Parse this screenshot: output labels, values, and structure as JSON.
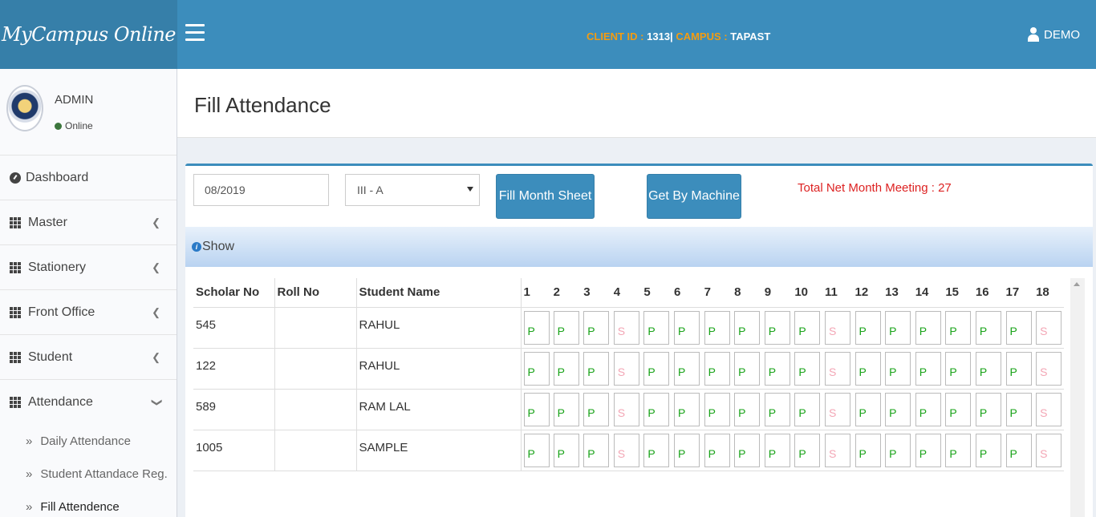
{
  "app": {
    "logo": "MyCampus Online"
  },
  "header": {
    "client_id_label": "CLIENT ID :",
    "client_id_value": "1313",
    "separator": "|",
    "campus_label": "CAMPUS :",
    "campus_value": "TAPAST",
    "user": "DEMO"
  },
  "sidebar": {
    "user_name": "ADMIN",
    "user_status": "Online",
    "items": [
      {
        "label": "Dashboard"
      },
      {
        "label": "Master"
      },
      {
        "label": "Stationery"
      },
      {
        "label": "Front Office"
      },
      {
        "label": "Student"
      },
      {
        "label": "Attendance"
      }
    ],
    "sub_items": [
      {
        "label": "Daily Attendance"
      },
      {
        "label": "Student Attandace Reg."
      },
      {
        "label": "Fill Attendence"
      }
    ]
  },
  "main": {
    "title": "Fill Attendance",
    "month_value": "08/2019",
    "class_value": "III - A",
    "fill_button": "Fill Month Sheet",
    "machine_button": "Get By Machine",
    "total_meeting": "Total Net Month Meeting : 27",
    "show_label": "Show",
    "table": {
      "headers": [
        "Scholar No",
        "Roll No",
        "Student Name"
      ],
      "days": [
        "1",
        "2",
        "3",
        "4",
        "5",
        "6",
        "7",
        "8",
        "9",
        "10",
        "11",
        "12",
        "13",
        "14",
        "15",
        "16",
        "17",
        "18"
      ],
      "rows": [
        {
          "scholar": "545",
          "roll": "",
          "name": "RAHUL",
          "marks": [
            "P",
            "P",
            "P",
            "S",
            "P",
            "P",
            "P",
            "P",
            "P",
            "P",
            "S",
            "P",
            "P",
            "P",
            "P",
            "P",
            "P",
            "S"
          ]
        },
        {
          "scholar": "122",
          "roll": "",
          "name": "RAHUL",
          "marks": [
            "P",
            "P",
            "P",
            "S",
            "P",
            "P",
            "P",
            "P",
            "P",
            "P",
            "S",
            "P",
            "P",
            "P",
            "P",
            "P",
            "P",
            "S"
          ]
        },
        {
          "scholar": "589",
          "roll": "",
          "name": "RAM LAL",
          "marks": [
            "P",
            "P",
            "P",
            "S",
            "P",
            "P",
            "P",
            "P",
            "P",
            "P",
            "S",
            "P",
            "P",
            "P",
            "P",
            "P",
            "P",
            "S"
          ]
        },
        {
          "scholar": "1005",
          "roll": "",
          "name": "SAMPLE",
          "marks": [
            "P",
            "P",
            "P",
            "S",
            "P",
            "P",
            "P",
            "P",
            "P",
            "P",
            "S",
            "P",
            "P",
            "P",
            "P",
            "P",
            "P",
            "S"
          ]
        }
      ]
    }
  }
}
